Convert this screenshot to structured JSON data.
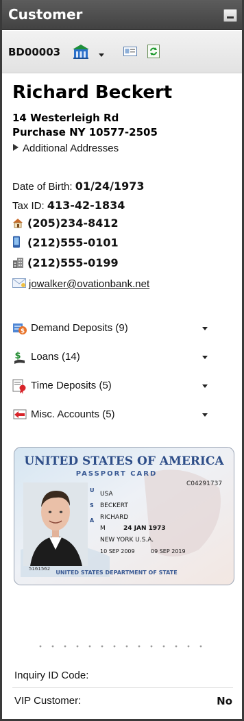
{
  "panel": {
    "title": "Customer"
  },
  "toolbar": {
    "customer_id": "BD00003",
    "icons": [
      "bank-building-icon",
      "contact-card-icon",
      "refresh-document-icon"
    ]
  },
  "customer": {
    "name": "Richard Beckert",
    "address_line1": "14 Westerleigh Rd",
    "address_line2": "Purchase NY 10577-2505",
    "additional_addresses_label": "Additional Addresses",
    "dob_label": "Date of Birth:",
    "dob": "01/24/1973",
    "tax_label": "Tax ID:",
    "tax_id": "413-42-1834",
    "home_phone": "(205)234-8412",
    "mobile_phone": "(212)555-0101",
    "work_phone": "(212)555-0199",
    "email": "jowalker@ovationbank.net"
  },
  "accounts": [
    {
      "label": "Demand Deposits (9)",
      "icon": "deposit-coins-icon"
    },
    {
      "label": "Loans (14)",
      "icon": "loan-dollar-icon"
    },
    {
      "label": "Time Deposits (5)",
      "icon": "certificate-ribbon-icon"
    },
    {
      "label": "Misc. Accounts (5)",
      "icon": "misc-account-arrow-icon"
    }
  ],
  "id_card": {
    "country": "UNITED STATES OF AMERICA",
    "doc_type": "PASSPORT CARD",
    "card_number": "C04291737",
    "nationality": "USA",
    "surname": "BECKERT",
    "given_name": "RICHARD",
    "sex": "M",
    "dob": "24 JAN 1973",
    "place_of_birth": "NEW YORK U.S.A.",
    "issued": "10 SEP 2009",
    "expires": "09 SEP 2019",
    "serial": "5161562",
    "footer": "UNITED STATES DEPARTMENT OF STATE"
  },
  "fields": [
    {
      "label": "Inquiry ID Code:",
      "value": ""
    },
    {
      "label": "VIP Customer:",
      "value": "No"
    }
  ]
}
